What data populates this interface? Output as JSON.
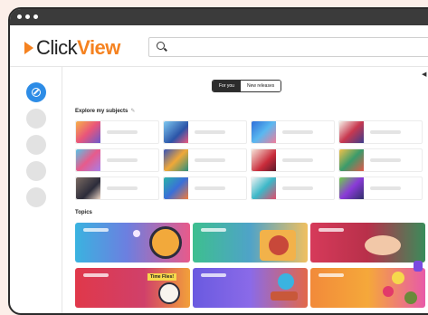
{
  "app": {
    "logo_part1": "Click",
    "logo_part2": "View",
    "brand_color": "#f58220",
    "accent_color": "#2d8ce6"
  },
  "search": {
    "placeholder": ""
  },
  "tabs": [
    {
      "label": "For you",
      "selected": true
    },
    {
      "label": "New releases",
      "selected": false
    }
  ],
  "sections": {
    "subjects_title": "Explore my subjects",
    "topics_title": "Topics"
  },
  "icons": {
    "search": "search-icon",
    "compass": "compass-icon",
    "edit": "pencil-icon",
    "back": "arrow-icon"
  },
  "topics_cards": [
    {
      "label": ""
    },
    {
      "label": ""
    },
    {
      "label": ""
    },
    {
      "label": "Time Flies!"
    },
    {
      "label": ""
    },
    {
      "label": ""
    }
  ]
}
